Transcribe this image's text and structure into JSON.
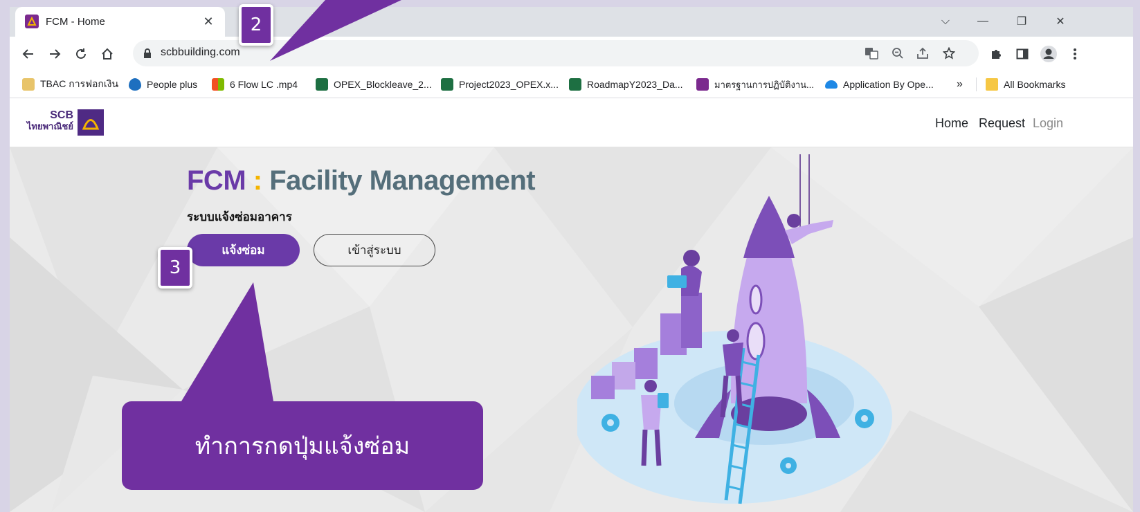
{
  "browser": {
    "tab": {
      "title": "FCM - Home",
      "close": "✕"
    },
    "window_controls": {
      "dropdown": "⌵",
      "minimize": "—",
      "restore": "❐",
      "close": "✕"
    },
    "url": "scbbuilding.com",
    "bookmarks": [
      {
        "label": "TBAC การฟอกเงิน",
        "icon_color": "#e8c46a"
      },
      {
        "label": "People plus",
        "icon_color": "#1e6fbf"
      },
      {
        "label": "6 Flow LC .mp4",
        "icon_color": "#f25022"
      },
      {
        "label": "OPEX_Blockleave_2...",
        "icon_color": "#1d6f42"
      },
      {
        "label": "Project2023_OPEX.x...",
        "icon_color": "#1d6f42"
      },
      {
        "label": "RoadmapY2023_Da...",
        "icon_color": "#1d6f42"
      },
      {
        "label": "มาตรฐานการปฏิบัติงาน...",
        "icon_color": "#7b2a8e"
      },
      {
        "label": "Application By Ope...",
        "icon_color": "#1e88e5"
      }
    ],
    "bookmarks_overflow": "»",
    "all_bookmarks": "All Bookmarks"
  },
  "site": {
    "logo": {
      "line1": "SCB",
      "line2": "ไทยพาณิชย์"
    },
    "nav": {
      "home": "Home",
      "request": "Request",
      "login": "Login"
    },
    "hero": {
      "title_a": "FCM",
      "title_sep": " : ",
      "title_b": "Facility Management",
      "subtitle": "ระบบแจ้งซ่อมอาคาร",
      "primary_button": "แจ้งซ่อม",
      "secondary_button": "เข้าสู่ระบบ"
    }
  },
  "annotations": {
    "step2": "2",
    "step3": "3",
    "callout": "ทำการกดปุ่มแจ้งซ่อม"
  },
  "colors": {
    "accent_purple": "#7030a0",
    "button_purple": "#6a3aa8",
    "title_fcm": "#6a3aa8",
    "title_colon": "#f4b400",
    "title_rest": "#546e7a"
  }
}
